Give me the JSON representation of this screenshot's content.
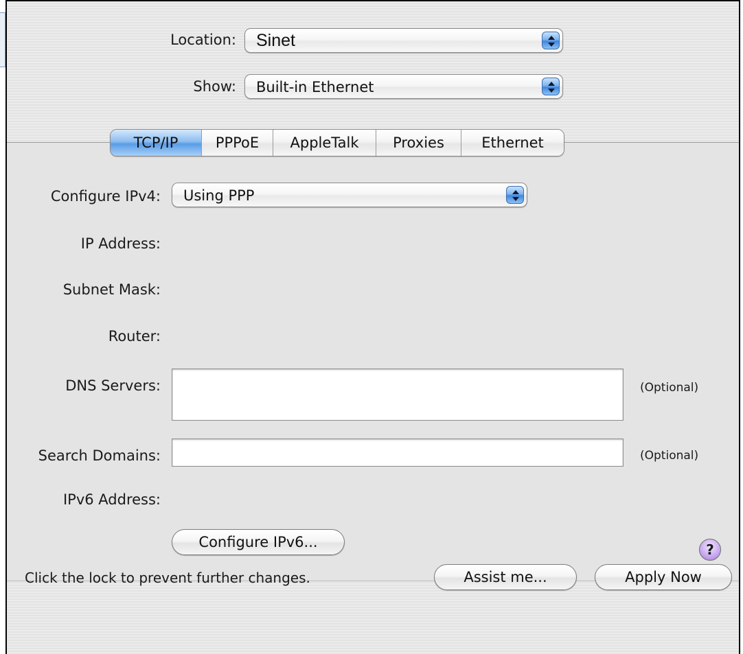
{
  "header": {
    "location_label": "Location:",
    "location_value": "Sinet",
    "show_label": "Show:",
    "show_value": "Built-in Ethernet"
  },
  "tabs": [
    {
      "label": "TCP/IP",
      "active": true
    },
    {
      "label": "PPPoE",
      "active": false
    },
    {
      "label": "AppleTalk",
      "active": false
    },
    {
      "label": "Proxies",
      "active": false
    },
    {
      "label": "Ethernet",
      "active": false
    }
  ],
  "tcpip": {
    "configure_label": "Configure IPv4:",
    "configure_value": "Using PPP",
    "ip_address_label": "IP Address:",
    "subnet_label": "Subnet Mask:",
    "router_label": "Router:",
    "dns_label": "DNS Servers:",
    "dns_value": "",
    "dns_optional": "(Optional)",
    "search_label": "Search Domains:",
    "search_value": "",
    "search_optional": "(Optional)",
    "ipv6_label": "IPv6 Address:",
    "configure_ipv6_button": "Configure IPv6...",
    "help_glyph": "?"
  },
  "footer": {
    "lock_text": "Click the lock to prevent further changes.",
    "assist_button": "Assist me...",
    "apply_button": "Apply Now"
  },
  "icons": {
    "popup_arrows": "up-down-arrows-icon",
    "help": "help-icon"
  },
  "colors": {
    "accent_blue": "#5a9de6",
    "help_purple": "#c7a6ef"
  }
}
